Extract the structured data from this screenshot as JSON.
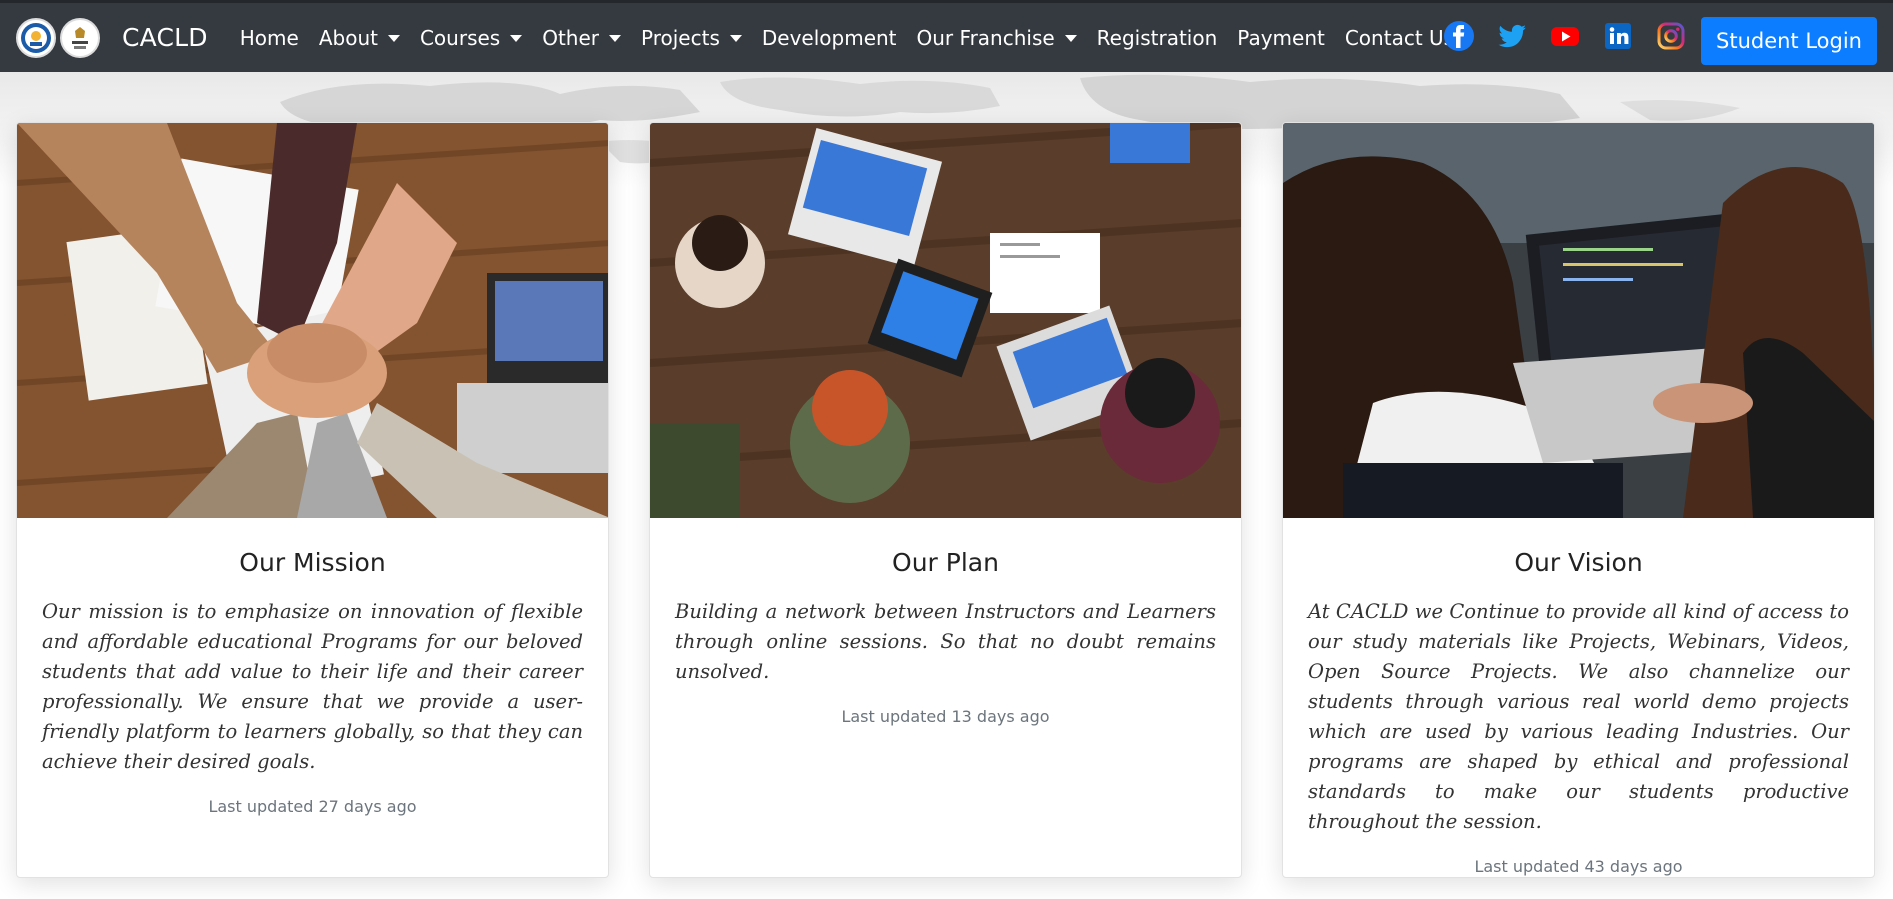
{
  "brand": {
    "name": "CACLD"
  },
  "nav": {
    "items": [
      {
        "label": "Home"
      },
      {
        "label": "About"
      },
      {
        "label": "Courses"
      },
      {
        "label": "Other"
      },
      {
        "label": "Projects"
      },
      {
        "label": "Development"
      },
      {
        "label": "Our Franchise"
      },
      {
        "label": "Registration"
      },
      {
        "label": "Payment"
      },
      {
        "label": "Contact Us"
      }
    ]
  },
  "socials": [
    {
      "icon": "facebook-icon",
      "color": "#1877f2"
    },
    {
      "icon": "twitter-icon",
      "color": "#1da1f2"
    },
    {
      "icon": "youtube-icon",
      "color": "#ff0000"
    },
    {
      "icon": "linkedin-icon",
      "color": "#0a66c2"
    },
    {
      "icon": "instagram-icon",
      "color": "#e1306c"
    }
  ],
  "login": {
    "label": "Student Login",
    "color": "#0d7dff"
  },
  "cards": [
    {
      "title": "Our Mission",
      "text": "Our mission is to emphasize on innovation of flexible and affordable educational Programs for our beloved students that add value to their life and their career professionally. We ensure that we provide a user-friendly platform to learners globally, so that they can achieve their desired goals.",
      "meta": "Last updated 27 days ago"
    },
    {
      "title": "Our Plan",
      "text": "Building a network between Instructors and Learners through online sessions. So that no doubt remains unsolved.",
      "meta": "Last updated 13 days ago"
    },
    {
      "title": "Our Vision",
      "text": "At CACLD we Continue to provide all kind of access to our study materials like Projects, Webinars, Videos, Open Source Projects. We also channelize our students through various real world demo projects which are used by various leading Industries. Our programs are shaped by ethical and professional standards to make our students productive throughout the session.",
      "meta": "Last updated 43 days ago"
    }
  ],
  "colors": {
    "navbar": "#343a40",
    "muted": "#6c757d"
  }
}
